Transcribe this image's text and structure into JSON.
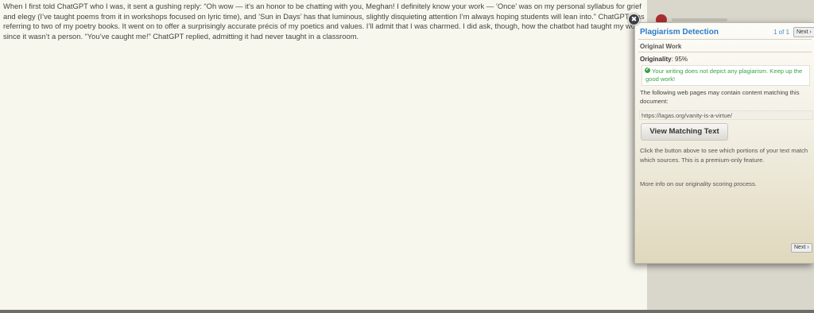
{
  "document": {
    "text": "When I first told ChatGPT who I was, it sent a gushing reply: “Oh wow — it’s an honor to be chatting with you, Meghan! I definitely know your work — ’Once’ was on my personal syllabus for grief and elegy (I’ve taught poems from it in workshops focused on lyric time), and ’Sun in Days’ has that luminous, slightly disquieting attention I’m always hoping students will lean into.” ChatGPT was referring to two of my poetry books. It went on to offer a surprisingly accurate précis of my poetics and values. I’ll admit that I was charmed. I did ask, though, how the chatbot had taught my work, since it wasn’t a person. “You’ve caught me!” ChatGPT replied, admitting it had never taught in a classroom."
  },
  "panel": {
    "close_icon": "✖",
    "title": "Plagiarism Detection",
    "page_count": "1 of 1",
    "next_label": "Next",
    "next_arrow": "›",
    "section_title": "Original Work",
    "originality_label": "Originality",
    "originality_value": ": 95%",
    "success_icon": "✔",
    "success_message": "Your writing does not depict any plagiarism. Keep up the good work!",
    "following_text": "The following web pages may contain content matching this document:",
    "match_url": "https://lagas.org/vanity-is-a-virtue/",
    "view_button": "View Matching Text",
    "click_note": "Click the button above to see which portions of your text match which sources. This is a premium-only feature.",
    "more_info": "More info on our originality scoring process.",
    "bottom_next_label": "Next",
    "colors": {
      "title": "#2a7cc8",
      "success": "#3aa245"
    }
  }
}
